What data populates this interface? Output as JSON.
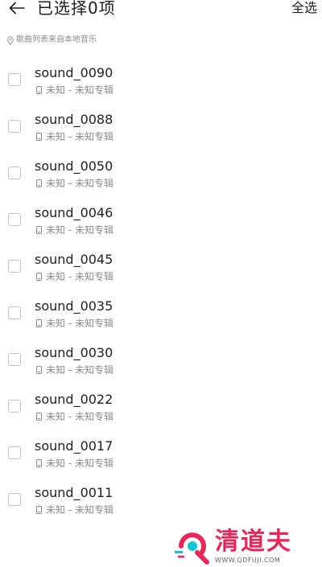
{
  "header": {
    "title": "已选择0项",
    "select_all_label": "全选"
  },
  "source_note": "歌曲列表来自本地音乐",
  "songs": [
    {
      "title": "sound_0090",
      "subtitle": "未知 - 未知专辑"
    },
    {
      "title": "sound_0088",
      "subtitle": "未知 - 未知专辑"
    },
    {
      "title": "sound_0050",
      "subtitle": "未知 - 未知专辑"
    },
    {
      "title": "sound_0046",
      "subtitle": "未知 - 未知专辑"
    },
    {
      "title": "sound_0045",
      "subtitle": "未知 - 未知专辑"
    },
    {
      "title": "sound_0035",
      "subtitle": "未知 - 未知专辑"
    },
    {
      "title": "sound_0030",
      "subtitle": "未知 - 未知专辑"
    },
    {
      "title": "sound_0022",
      "subtitle": "未知 - 未知专辑"
    },
    {
      "title": "sound_0017",
      "subtitle": "未知 - 未知专辑"
    },
    {
      "title": "sound_0011",
      "subtitle": "未知 - 未知专辑"
    }
  ],
  "watermark": {
    "name": "清道夫",
    "url": "WWW.QDFUJI.COM"
  },
  "icons": {
    "back": "arrow-left-icon",
    "location": "location-pin-icon",
    "device": "phone-icon",
    "checkbox": "checkbox-unchecked"
  }
}
